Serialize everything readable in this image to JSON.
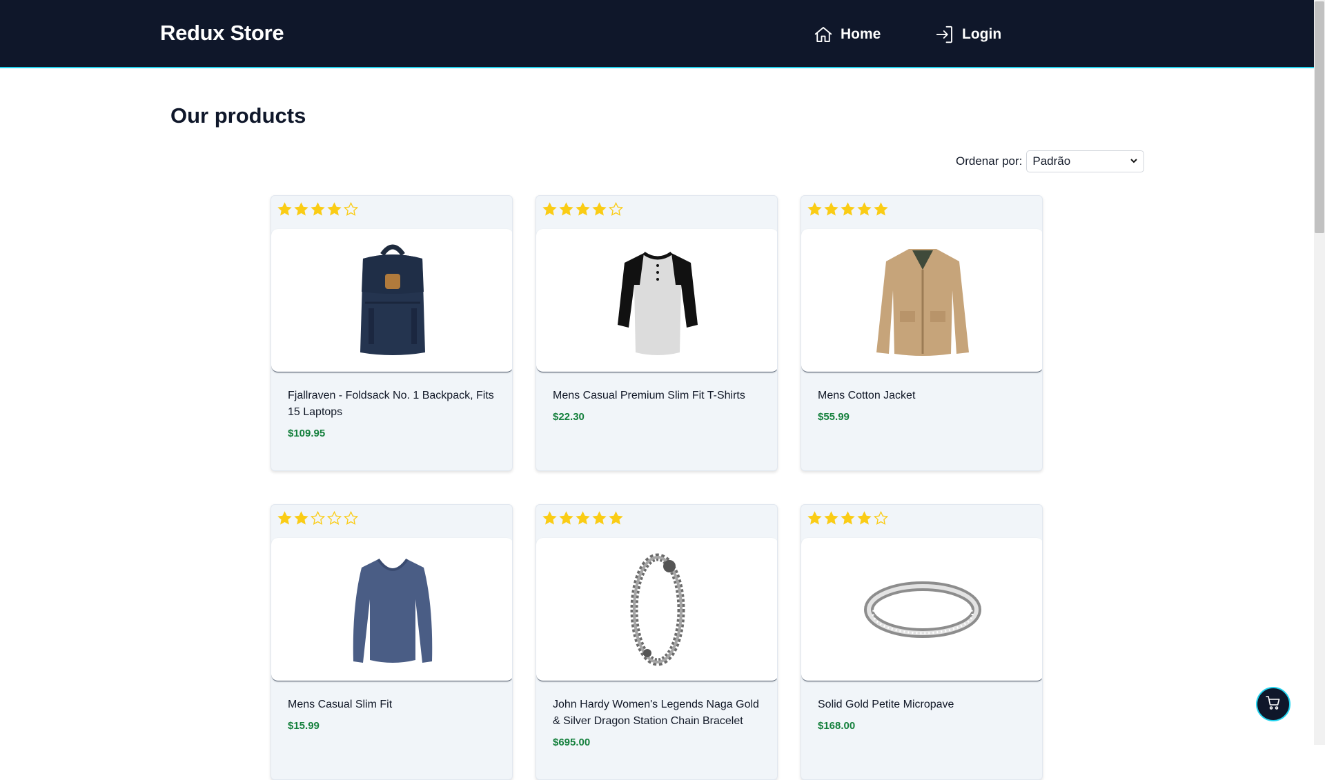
{
  "header": {
    "brand": "Redux Store",
    "nav": [
      {
        "label": "Home",
        "icon": "home-icon"
      },
      {
        "label": "Login",
        "icon": "login-icon"
      }
    ]
  },
  "main": {
    "title": "Our products",
    "sort": {
      "label": "Ordenar por:",
      "selected": "Padrão"
    }
  },
  "products": [
    {
      "title": "Fjallraven - Foldsack No. 1 Backpack, Fits 15 Laptops",
      "price": "$109.95",
      "rating": 4,
      "image": "backpack-image"
    },
    {
      "title": "Mens Casual Premium Slim Fit T-Shirts",
      "price": "$22.30",
      "rating": 4,
      "image": "t-shirt-image"
    },
    {
      "title": "Mens Cotton Jacket",
      "price": "$55.99",
      "rating": 5,
      "image": "jacket-image"
    },
    {
      "title": "Mens Casual Slim Fit",
      "price": "$15.99",
      "rating": 2,
      "image": "long-sleeve-shirt-image"
    },
    {
      "title": "John Hardy Women's Legends Naga Gold & Silver Dragon Station Chain Bracelet",
      "price": "$695.00",
      "rating": 5,
      "image": "bracelet-image"
    },
    {
      "title": "Solid Gold Petite Micropave",
      "price": "$168.00",
      "rating": 4,
      "image": "ring-image"
    }
  ],
  "cart": {
    "icon": "cart-icon"
  },
  "colors": {
    "navbar": "#0f172a",
    "accent": "#22d3ee",
    "star": "#facc15",
    "price": "#15803d",
    "card": "#f1f5f9"
  }
}
